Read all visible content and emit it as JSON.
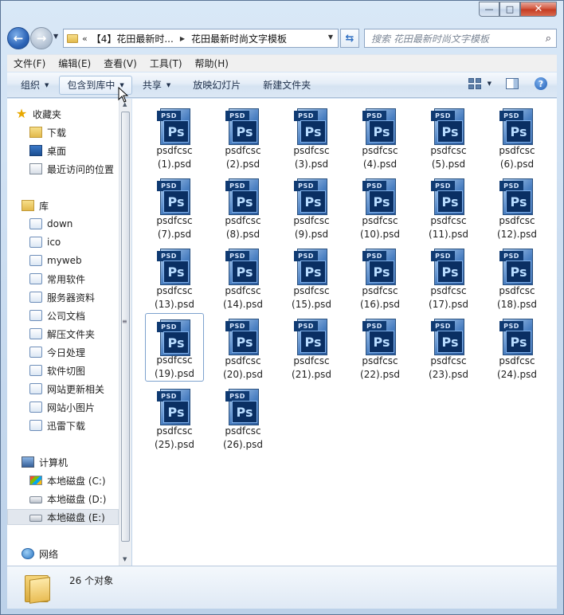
{
  "window": {
    "caption": {
      "minimize": "—",
      "maximize": "□",
      "close": "✕"
    }
  },
  "address_bar": {
    "overflow_marker": "«",
    "crumbs": [
      "【4】花田最新时...",
      "花田最新时尚文字模板"
    ],
    "search_placeholder": "搜索 花田最新时尚文字模板",
    "icons": [
      "back-arrow-icon",
      "forward-arrow-icon",
      "refresh-icon",
      "search-icon"
    ]
  },
  "menu": [
    "文件(F)",
    "编辑(E)",
    "查看(V)",
    "工具(T)",
    "帮助(H)"
  ],
  "toolbar": {
    "organize": "组织",
    "include_in_library": "包含到库中",
    "share": "共享",
    "slideshow": "放映幻灯片",
    "new_folder": "新建文件夹"
  },
  "nav": {
    "favorites": {
      "label": "收藏夹",
      "items": [
        "下载",
        "桌面",
        "最近访问的位置"
      ]
    },
    "libraries": {
      "label": "库",
      "items": [
        "down",
        "ico",
        "myweb",
        "常用软件",
        "服务器资料",
        "公司文档",
        "解压文件夹",
        "今日处理",
        "软件切图",
        "网站更新相关",
        "网站小图片",
        "迅雷下载"
      ]
    },
    "computer": {
      "label": "计算机",
      "items": [
        "本地磁盘 (C:)",
        "本地磁盘 (D:)",
        "本地磁盘 (E:)"
      ],
      "selected": "本地磁盘 (E:)"
    },
    "network": {
      "label": "网络"
    }
  },
  "file_icon": {
    "tag": "PSD",
    "glyph": "Ps"
  },
  "files": [
    {
      "name": "psdfcsc",
      "suffix": "(1).psd"
    },
    {
      "name": "psdfcsc",
      "suffix": "(2).psd"
    },
    {
      "name": "psdfcsc",
      "suffix": "(3).psd"
    },
    {
      "name": "psdfcsc",
      "suffix": "(4).psd"
    },
    {
      "name": "psdfcsc",
      "suffix": "(5).psd"
    },
    {
      "name": "psdfcsc",
      "suffix": "(6).psd"
    },
    {
      "name": "psdfcsc",
      "suffix": "(7).psd"
    },
    {
      "name": "psdfcsc",
      "suffix": "(8).psd"
    },
    {
      "name": "psdfcsc",
      "suffix": "(9).psd"
    },
    {
      "name": "psdfcsc",
      "suffix": "(10).psd"
    },
    {
      "name": "psdfcsc",
      "suffix": "(11).psd"
    },
    {
      "name": "psdfcsc",
      "suffix": "(12).psd"
    },
    {
      "name": "psdfcsc",
      "suffix": "(13).psd"
    },
    {
      "name": "psdfcsc",
      "suffix": "(14).psd"
    },
    {
      "name": "psdfcsc",
      "suffix": "(15).psd"
    },
    {
      "name": "psdfcsc",
      "suffix": "(16).psd"
    },
    {
      "name": "psdfcsc",
      "suffix": "(17).psd"
    },
    {
      "name": "psdfcsc",
      "suffix": "(18).psd"
    },
    {
      "name": "psdfcsc",
      "suffix": "(19).psd",
      "focused": true
    },
    {
      "name": "psdfcsc",
      "suffix": "(20).psd"
    },
    {
      "name": "psdfcsc",
      "suffix": "(21).psd"
    },
    {
      "name": "psdfcsc",
      "suffix": "(22).psd"
    },
    {
      "name": "psdfcsc",
      "suffix": "(23).psd"
    },
    {
      "name": "psdfcsc",
      "suffix": "(24).psd"
    },
    {
      "name": "psdfcsc",
      "suffix": "(25).psd"
    },
    {
      "name": "psdfcsc",
      "suffix": "(26).psd"
    }
  ],
  "status": {
    "count_text": "26 个对象"
  },
  "colors": {
    "accent": "#2c64b7",
    "selection_border": "#7da2ce",
    "psd_blue": "#0a2f63"
  }
}
